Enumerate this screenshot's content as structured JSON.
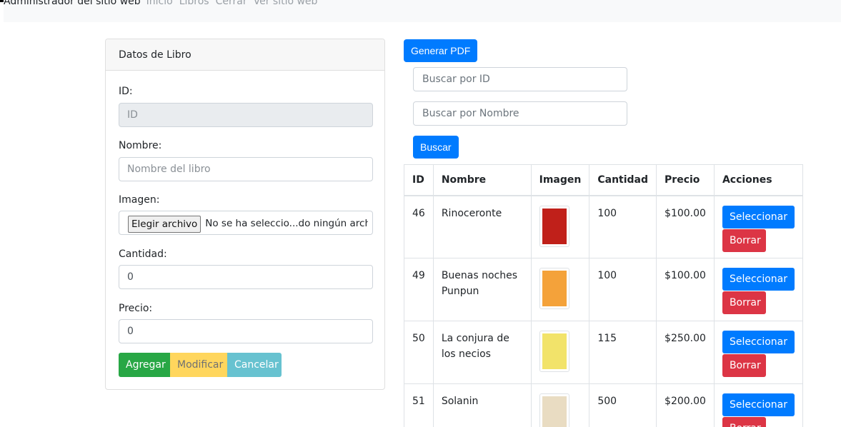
{
  "nav": {
    "brand": "Administrador del sitio web",
    "links": [
      "Inicio",
      "Libros",
      "Cerrar",
      "Ver sitio web"
    ]
  },
  "form": {
    "header": "Datos de Libro",
    "id_label": "ID:",
    "id_placeholder": "ID",
    "name_label": "Nombre:",
    "name_placeholder": "Nombre del libro",
    "image_label": "Imagen:",
    "file_button": "Elegir archivo",
    "file_status": "No se ha seleccio...do ningún archivo",
    "qty_label": "Cantidad:",
    "qty_value": "0",
    "price_label": "Precio:",
    "price_value": "0",
    "buttons": {
      "add": "Agregar",
      "modify": "Modificar",
      "cancel": "Cancelar"
    }
  },
  "toolbar": {
    "pdf_button": "Generar PDF",
    "search_id_placeholder": "Buscar por ID",
    "search_name_placeholder": "Buscar por Nombre",
    "search_button": "Buscar"
  },
  "table": {
    "headers": [
      "ID",
      "Nombre",
      "Imagen",
      "Cantidad",
      "Precio",
      "Acciones"
    ],
    "select_label": "Seleccionar",
    "delete_label": "Borrar",
    "rows": [
      {
        "id": "46",
        "name": "Rinoceronte",
        "qty": "100",
        "price": "$100.00",
        "cover_color": "#c0201a"
      },
      {
        "id": "49",
        "name": "Buenas noches Punpun",
        "qty": "100",
        "price": "$100.00",
        "cover_color": "#f4a23a"
      },
      {
        "id": "50",
        "name": "La conjura de los necios",
        "qty": "115",
        "price": "$250.00",
        "cover_color": "#f2e36a"
      },
      {
        "id": "51",
        "name": "Solanin",
        "qty": "500",
        "price": "$200.00",
        "cover_color": "#e9dcc2"
      }
    ]
  }
}
